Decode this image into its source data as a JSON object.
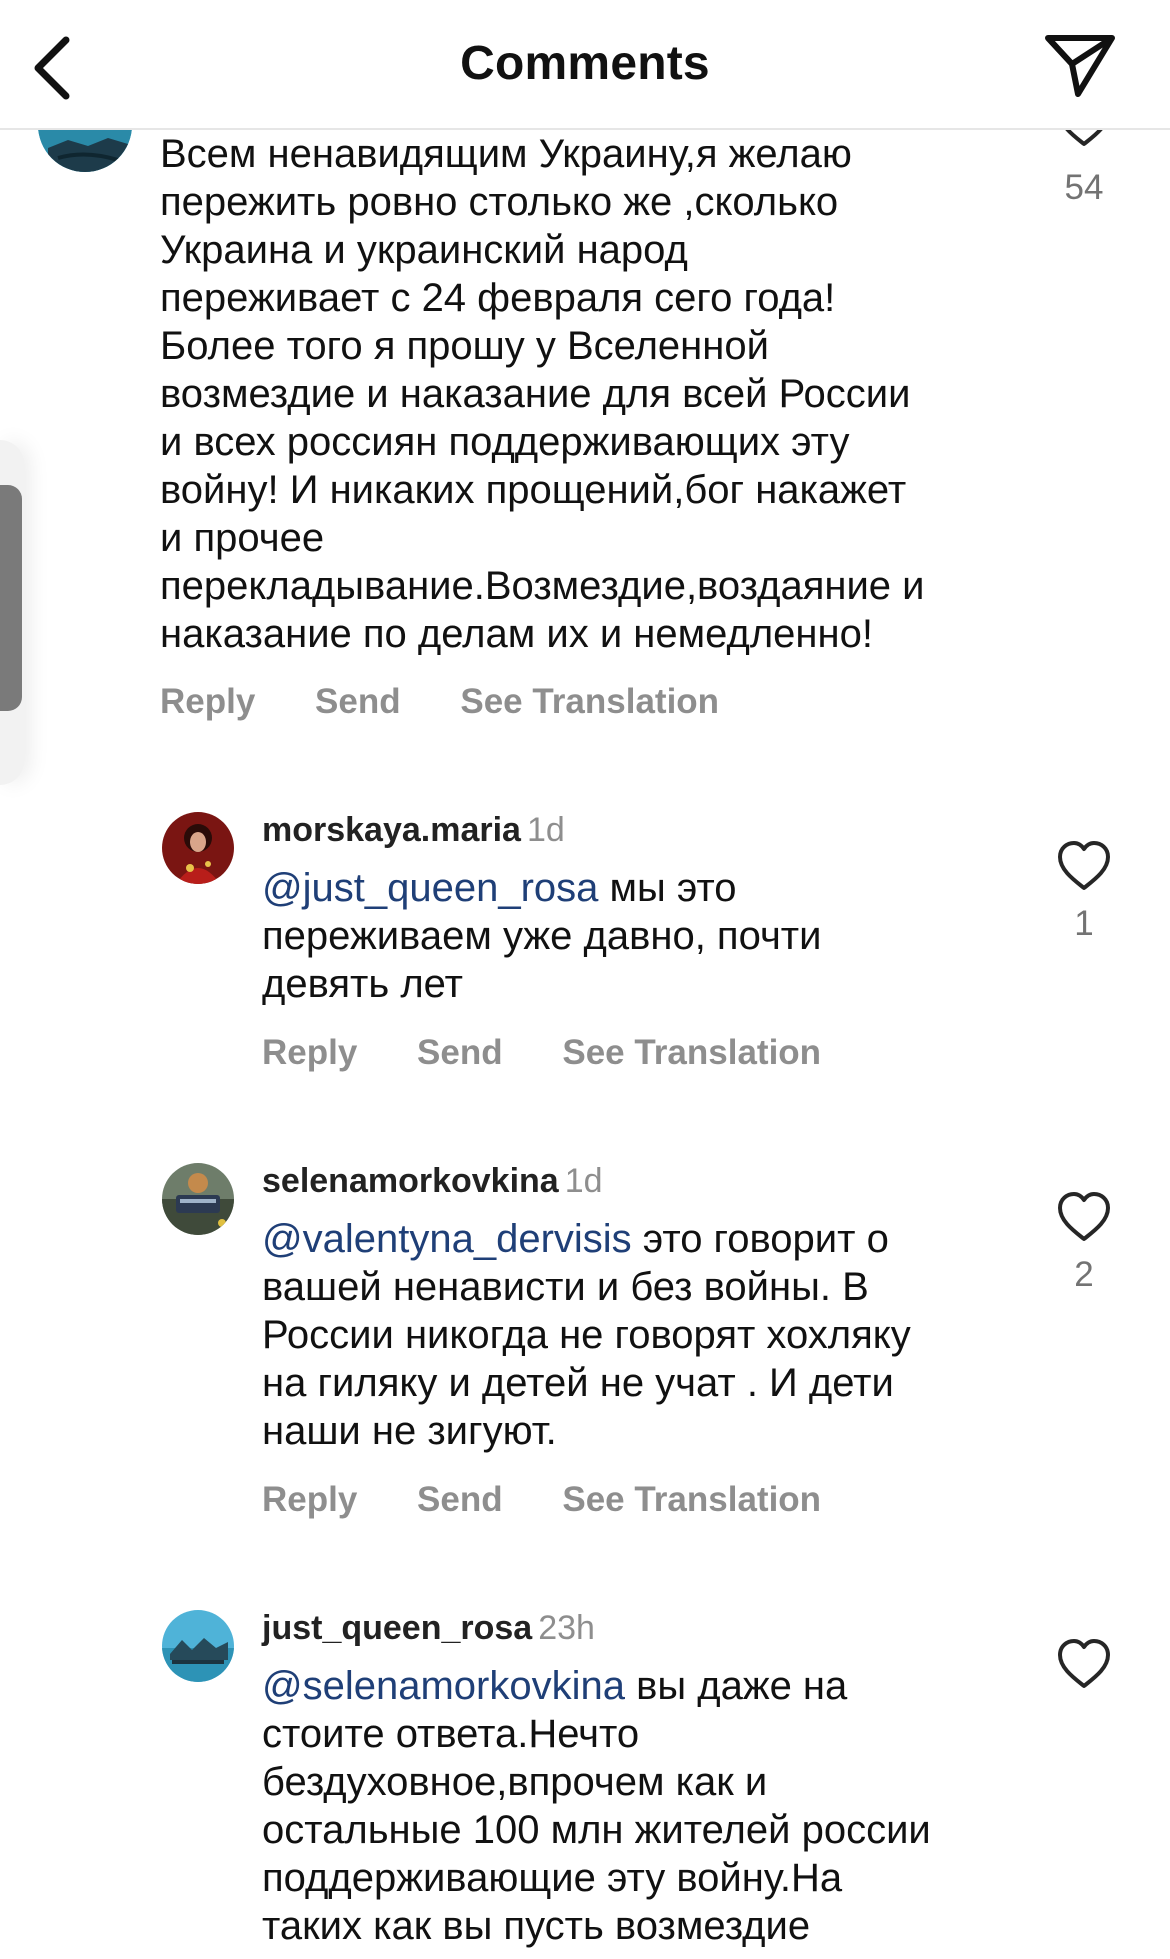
{
  "header": {
    "title": "Comments"
  },
  "comments": [
    {
      "text": "Всем ненавидящим Украину,я желаю\nпережить ровно столько же ,сколько\nУкраина и украинский народ\nпереживает с 24 февраля сего года!\nБолее того я прошу у Вселенной\nвозмездие и наказание для всей России\nи всех россиян поддерживающих эту\nвойну! И никаких прощений,бог накажет\nи прочее\nперекладывание.Возмездие,воздаяние и\nнаказание по делам их и немедленно!",
      "likes": "54",
      "actions": {
        "reply": "Reply",
        "send": "Send",
        "translate": "See Translation"
      }
    },
    {
      "username": "morskaya.maria",
      "time": "1d",
      "mention": "@just_queen_rosa",
      "text_first": " мы это",
      "text_rest": "переживаем уже давно, почти\nдевять лет",
      "likes": "1",
      "actions": {
        "reply": "Reply",
        "send": "Send",
        "translate": "See Translation"
      }
    },
    {
      "username": "selenamorkovkina",
      "time": "1d",
      "mention": "@valentyna_dervisis",
      "text_first": " это говорит о",
      "text_rest": "вашей ненависти и без войны. В\nРоссии никогда не говорят хохляку\nна гиляку и детей не учат . И дети\nнаши не зигуют.",
      "likes": "2",
      "actions": {
        "reply": "Reply",
        "send": "Send",
        "translate": "See Translation"
      }
    },
    {
      "username": "just_queen_rosa",
      "time": "23h",
      "mention": "@selenamorkovkina",
      "text_first": " вы даже на",
      "text_rest": "стоите ответа.Нечто\nбездуховное,впрочем как и\nостальные 100 млн жителей россии\nподдерживающие эту войну.На\nтаких как вы пусть возмездие"
    }
  ],
  "colors": {
    "mention": "#1f3f77",
    "muted": "#8e8e8e",
    "text": "#111111"
  }
}
